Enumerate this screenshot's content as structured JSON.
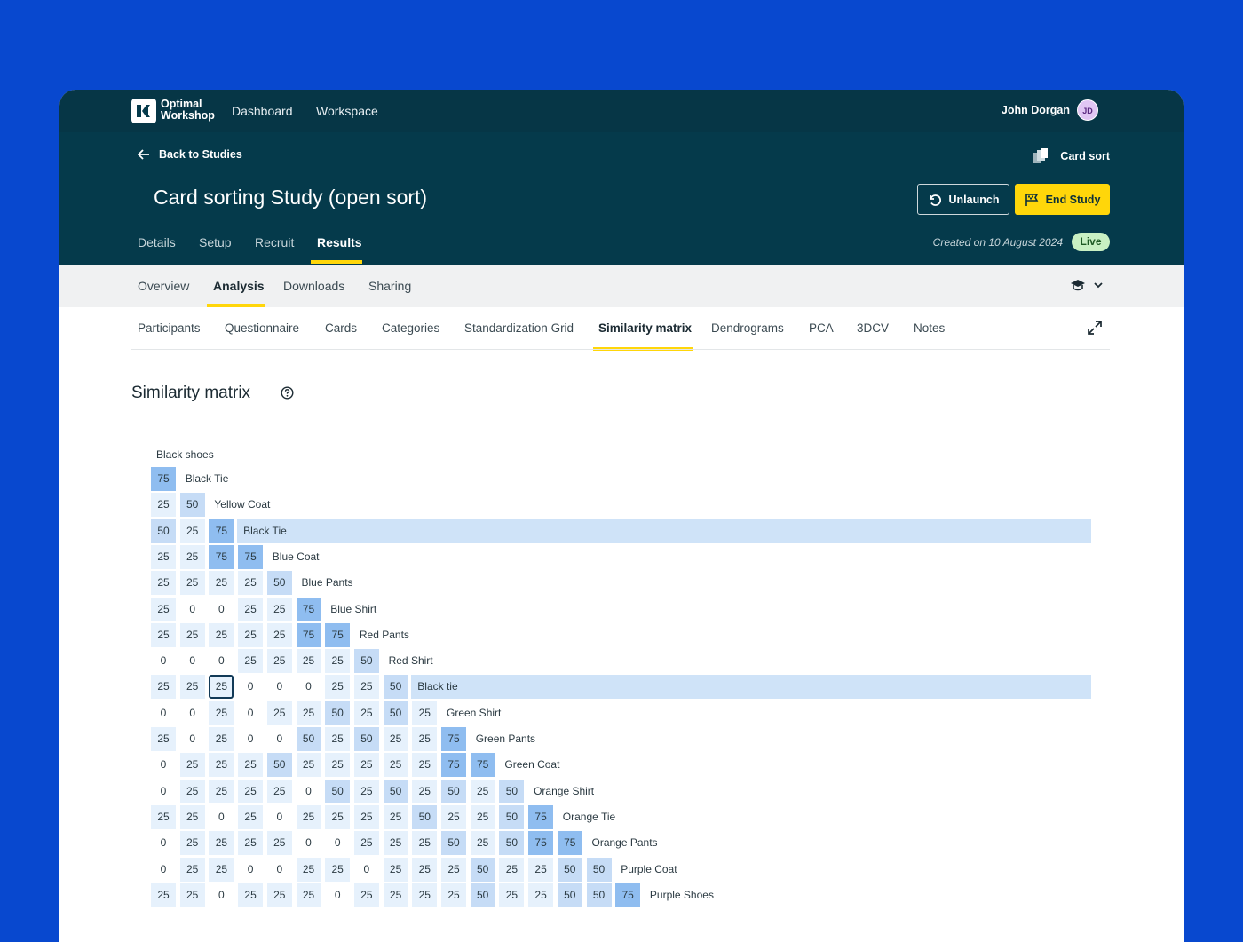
{
  "app": {
    "logo_line1": "Optimal",
    "logo_line2": "Workshop",
    "nav": [
      "Dashboard",
      "Workspace"
    ],
    "user_name": "John Dorgan",
    "user_initials": "JD"
  },
  "study": {
    "back_label": "Back to Studies",
    "type_label": "Card sort",
    "title": "Card sorting Study (open sort)",
    "unlaunch_label": "Unlaunch",
    "end_label": "End Study",
    "tabs": [
      "Details",
      "Setup",
      "Recruit",
      "Results"
    ],
    "active_tab": "Results",
    "created": "Created on 10 August 2024",
    "status": "Live"
  },
  "results_tabs": [
    "Overview",
    "Analysis",
    "Downloads",
    "Sharing"
  ],
  "analysis_tabs": [
    "Participants",
    "Questionnaire",
    "Cards",
    "Categories",
    "Standardization Grid",
    "Similarity matrix",
    "Dendrograms",
    "PCA",
    "3DCV",
    "Notes"
  ],
  "section_title": "Similarity matrix",
  "colors": {
    "brand_bg": "#0848cf",
    "header": "#053a4b",
    "accent": "#ffd60a",
    "cell_25": "#e6f1fc",
    "cell_50": "#c6dcf6",
    "cell_75": "#8fbdf0",
    "highlight": "#cfe3f8"
  },
  "matrix": {
    "first_label": "Black shoes",
    "rows": [
      {
        "label": "Black Tie",
        "values": [
          75
        ]
      },
      {
        "label": "Yellow Coat",
        "values": [
          25,
          50
        ]
      },
      {
        "label": "Black Tie",
        "values": [
          50,
          25,
          75
        ],
        "highlight": true
      },
      {
        "label": "Blue Coat",
        "values": [
          25,
          25,
          75,
          75
        ]
      },
      {
        "label": "Blue Pants",
        "values": [
          25,
          25,
          25,
          25,
          50
        ]
      },
      {
        "label": "Blue Shirt",
        "values": [
          25,
          0,
          0,
          25,
          25,
          75
        ]
      },
      {
        "label": "Red Pants",
        "values": [
          25,
          25,
          25,
          25,
          25,
          75,
          75
        ]
      },
      {
        "label": "Red Shirt",
        "values": [
          0,
          0,
          0,
          25,
          25,
          25,
          25,
          50
        ]
      },
      {
        "label": "Black tie",
        "values": [
          25,
          25,
          25,
          0,
          0,
          0,
          25,
          25,
          50
        ],
        "highlight": true,
        "selected_col": 2
      },
      {
        "label": "Green Shirt",
        "values": [
          0,
          0,
          25,
          0,
          25,
          25,
          50,
          25,
          50,
          25
        ]
      },
      {
        "label": "Green Pants",
        "values": [
          25,
          0,
          25,
          0,
          0,
          50,
          25,
          50,
          25,
          25,
          75
        ]
      },
      {
        "label": "Green Coat",
        "values": [
          0,
          25,
          25,
          25,
          50,
          25,
          25,
          25,
          25,
          25,
          75,
          75
        ]
      },
      {
        "label": "Orange Shirt",
        "values": [
          0,
          25,
          25,
          25,
          25,
          0,
          50,
          25,
          50,
          25,
          50,
          25,
          50
        ]
      },
      {
        "label": "Orange Tie",
        "values": [
          25,
          25,
          0,
          25,
          0,
          25,
          25,
          25,
          25,
          50,
          25,
          25,
          50,
          75
        ]
      },
      {
        "label": "Orange Pants",
        "values": [
          0,
          25,
          25,
          25,
          25,
          0,
          0,
          25,
          25,
          25,
          50,
          25,
          50,
          75,
          75
        ]
      },
      {
        "label": "Purple Coat",
        "values": [
          0,
          25,
          25,
          0,
          0,
          25,
          25,
          0,
          25,
          25,
          25,
          50,
          25,
          25,
          50,
          50
        ]
      },
      {
        "label": "Purple Shoes",
        "values": [
          25,
          25,
          0,
          25,
          25,
          25,
          0,
          25,
          25,
          25,
          25,
          50,
          25,
          25,
          50,
          50,
          75
        ]
      }
    ]
  }
}
